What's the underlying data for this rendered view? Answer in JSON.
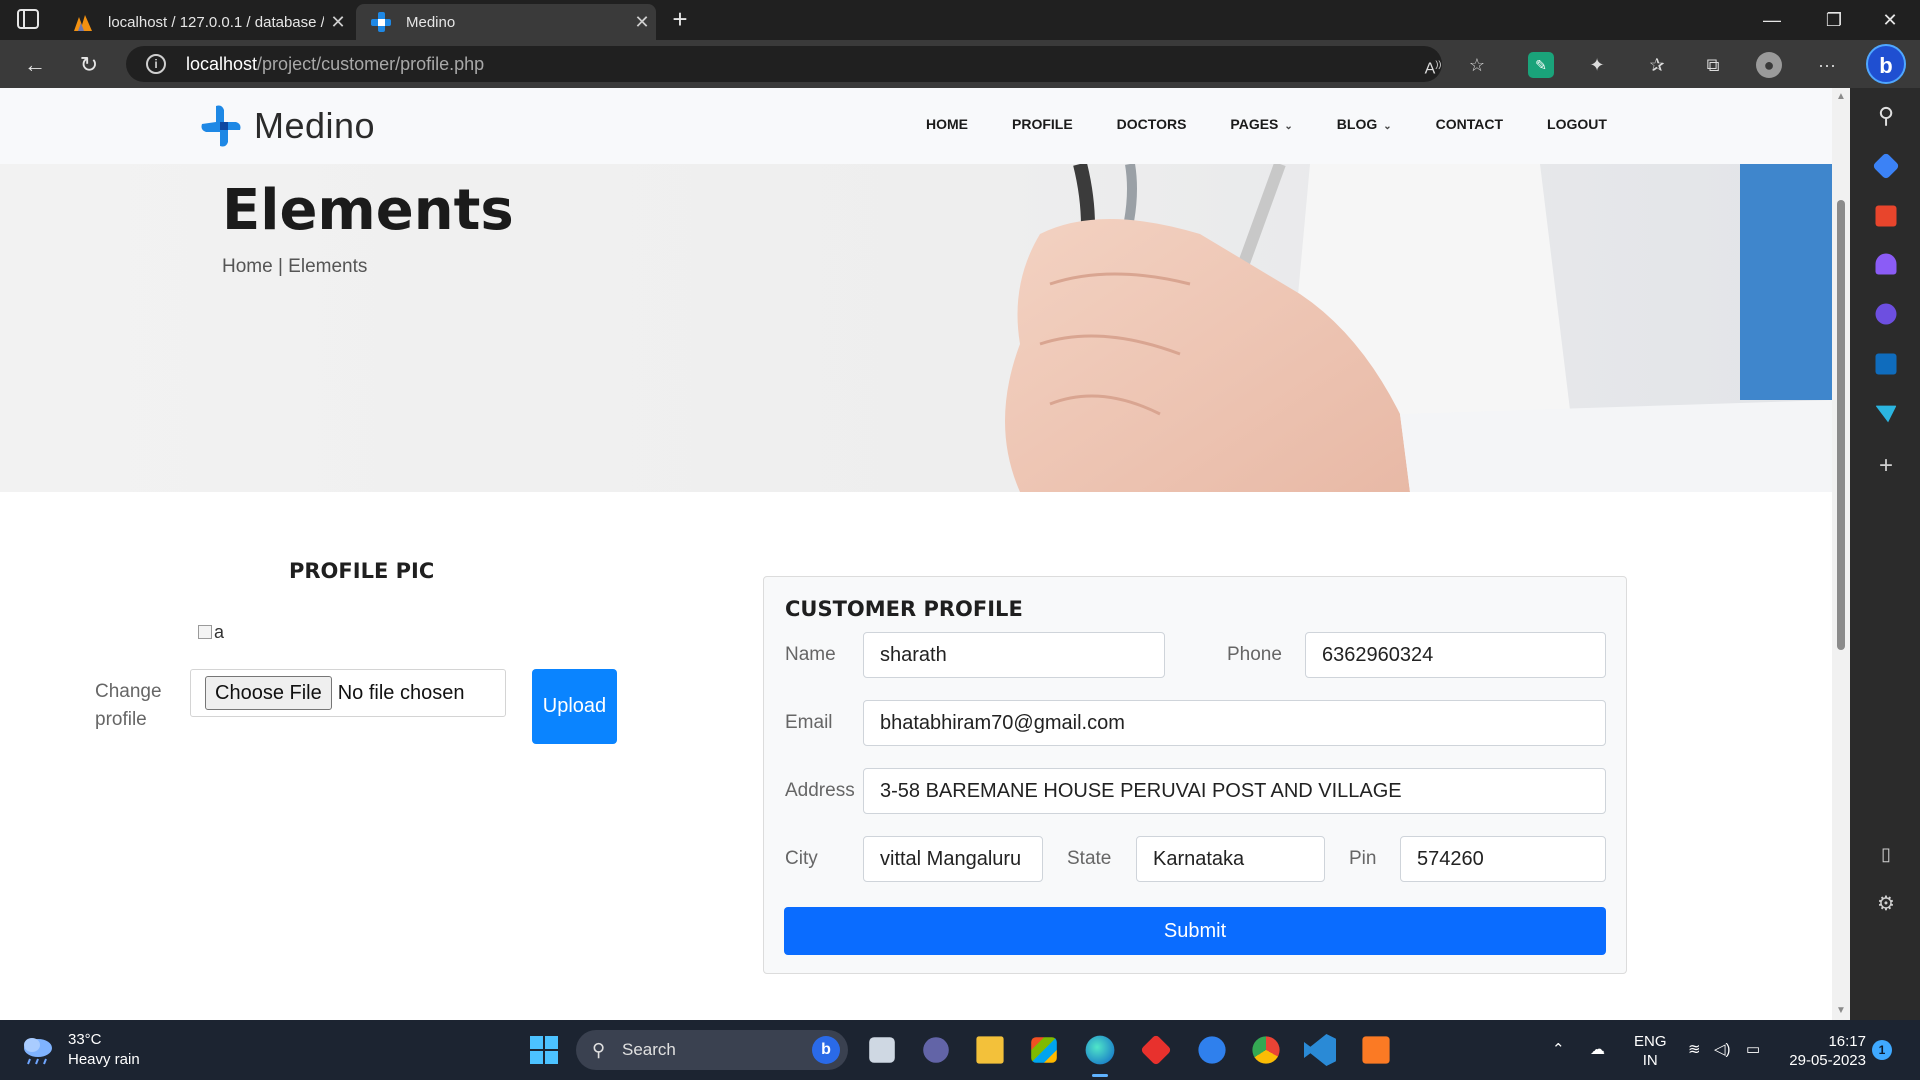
{
  "browser": {
    "tabs": [
      {
        "title": "localhost / 127.0.0.1 / database / ",
        "active": false
      },
      {
        "title": "Medino",
        "active": true
      }
    ],
    "url_host": "localhost",
    "url_path": "/project/customer/profile.php",
    "bing_label": "b"
  },
  "site": {
    "logo_text": "Medino",
    "menu": [
      {
        "label": "HOME"
      },
      {
        "label": "PROFILE"
      },
      {
        "label": "DOCTORS"
      },
      {
        "label": "PAGES",
        "has_dropdown": true
      },
      {
        "label": "BLOG",
        "has_dropdown": true
      },
      {
        "label": "CONTACT"
      },
      {
        "label": "LOGOUT"
      }
    ],
    "hero": {
      "title": "Elements",
      "breadcrumb": "Home | Elements"
    }
  },
  "profile_pic": {
    "heading": "PROFILE PIC",
    "img_alt": "a",
    "change_label_1": "Change",
    "change_label_2": "profile",
    "choose_file_label": "Choose File",
    "file_status": "No file chosen",
    "upload_label": "Upload"
  },
  "customer_profile": {
    "heading": "CUSTOMER PROFILE",
    "labels": {
      "name": "Name",
      "phone": "Phone",
      "email": "Email",
      "address": "Address",
      "city": "City",
      "state": "State",
      "pin": "Pin"
    },
    "values": {
      "name": "sharath",
      "phone": "6362960324",
      "email": "bhatabhiram70@gmail.com",
      "address": "3-58 BAREMANE HOUSE PERUVAI POST AND VILLAGE",
      "city": "vittal Mangaluru",
      "state": "Karnataka",
      "pin": "574260"
    },
    "submit_label": "Submit"
  },
  "taskbar": {
    "weather_temp": "33°C",
    "weather_desc": "Heavy rain",
    "search_label": "Search",
    "lang_1": "ENG",
    "lang_2": "IN",
    "time": "16:17",
    "date": "29-05-2023",
    "notification_count": "1"
  }
}
